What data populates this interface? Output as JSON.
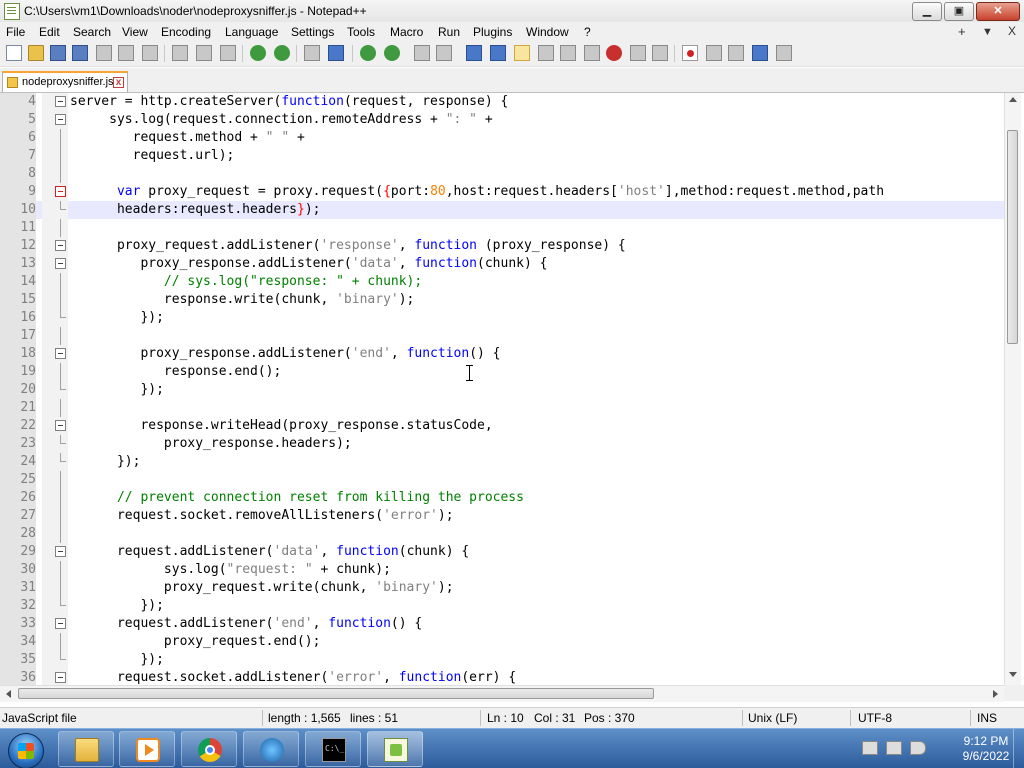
{
  "window": {
    "title": "C:\\Users\\vm1\\Downloads\\noder\\nodeproxysniffer.js - Notepad++",
    "minimize": "▁",
    "maximize": "▣",
    "close": "✕"
  },
  "menu": {
    "items": [
      "File",
      "Edit",
      "Search",
      "View",
      "Encoding",
      "Language",
      "Settings",
      "Tools",
      "Macro",
      "Run",
      "Plugins",
      "Window",
      "?"
    ],
    "right_plus": "+",
    "right_down": "▼",
    "right_close": "X"
  },
  "tab": {
    "label": "nodeproxysniffer.js",
    "close": "x"
  },
  "editor": {
    "lines": [
      {
        "n": "4",
        "html": "server = http.createServer(<span class='kw'>function</span>(request, response) {",
        "fold": "box",
        "current": false
      },
      {
        "n": "5",
        "html": "     sys.log(request.connection.remoteAddress + <span class='str'>\": \"</span> +",
        "fold": "box",
        "current": false
      },
      {
        "n": "6",
        "html": "        request.method + <span class='str'>\" \"</span> +",
        "fold": "line",
        "current": false
      },
      {
        "n": "7",
        "html": "        request.url);",
        "fold": "line",
        "current": false
      },
      {
        "n": "8",
        "html": "",
        "fold": "line",
        "current": false
      },
      {
        "n": "9",
        "html": "      <span class='kw'>var</span> proxy_request = proxy.request(<span class='brace-red'>{</span>port:<span class='num'>80</span>,host:request.headers[<span class='str'>'host'</span>],method:request.method,path",
        "fold": "redbox",
        "current": false
      },
      {
        "n": "10",
        "html": "      headers:request.headers<span class='brace-red'>}</span>);",
        "fold": "end",
        "current": true
      },
      {
        "n": "11",
        "html": "",
        "fold": "line",
        "current": false
      },
      {
        "n": "12",
        "html": "      proxy_request.addListener(<span class='str'>'response'</span>, <span class='kw'>function</span> (proxy_response) {",
        "fold": "box",
        "current": false
      },
      {
        "n": "13",
        "html": "         proxy_response.addListener(<span class='str'>'data'</span>, <span class='kw'>function</span>(chunk) {",
        "fold": "box",
        "current": false
      },
      {
        "n": "14",
        "html": "            <span class='com'>// sys.log(\"response: \" + chunk);</span>",
        "fold": "line",
        "current": false
      },
      {
        "n": "15",
        "html": "            response.write(chunk, <span class='str'>'binary'</span>);",
        "fold": "line",
        "current": false
      },
      {
        "n": "16",
        "html": "         });",
        "fold": "end",
        "current": false
      },
      {
        "n": "17",
        "html": "",
        "fold": "line",
        "current": false
      },
      {
        "n": "18",
        "html": "         proxy_response.addListener(<span class='str'>'end'</span>, <span class='kw'>function</span>() {",
        "fold": "box",
        "current": false
      },
      {
        "n": "19",
        "html": "            response.end();",
        "fold": "line",
        "current": false
      },
      {
        "n": "20",
        "html": "         });",
        "fold": "end",
        "current": false
      },
      {
        "n": "21",
        "html": "",
        "fold": "line",
        "current": false
      },
      {
        "n": "22",
        "html": "         response.writeHead(proxy_response.statusCode,",
        "fold": "box",
        "current": false
      },
      {
        "n": "23",
        "html": "            proxy_response.headers);",
        "fold": "end",
        "current": false
      },
      {
        "n": "24",
        "html": "      });",
        "fold": "end",
        "current": false
      },
      {
        "n": "25",
        "html": "",
        "fold": "line",
        "current": false
      },
      {
        "n": "26",
        "html": "      <span class='com'>// prevent connection reset from killing the process</span>",
        "fold": "line",
        "current": false
      },
      {
        "n": "27",
        "html": "      request.socket.removeAllListeners(<span class='str'>'error'</span>);",
        "fold": "line",
        "current": false
      },
      {
        "n": "28",
        "html": "",
        "fold": "line",
        "current": false
      },
      {
        "n": "29",
        "html": "      request.addListener(<span class='str'>'data'</span>, <span class='kw'>function</span>(chunk) {",
        "fold": "box",
        "current": false
      },
      {
        "n": "30",
        "html": "            sys.log(<span class='str'>\"request: \"</span> + chunk);",
        "fold": "line",
        "current": false
      },
      {
        "n": "31",
        "html": "            proxy_request.write(chunk, <span class='str'>'binary'</span>);",
        "fold": "line",
        "current": false
      },
      {
        "n": "32",
        "html": "         });",
        "fold": "end",
        "current": false
      },
      {
        "n": "33",
        "html": "      request.addListener(<span class='str'>'end'</span>, <span class='kw'>function</span>() {",
        "fold": "box",
        "current": false
      },
      {
        "n": "34",
        "html": "            proxy_request.end();",
        "fold": "line",
        "current": false
      },
      {
        "n": "35",
        "html": "         });",
        "fold": "end",
        "current": false
      },
      {
        "n": "36",
        "html": "      request.socket.addListener(<span class='str'>'error'</span>, <span class='kw'>function</span>(err) {",
        "fold": "box",
        "current": false
      }
    ]
  },
  "status": {
    "language": "JavaScript file",
    "length": "length : 1,565",
    "lines": "lines : 51",
    "ln": "Ln : 10",
    "col": "Col : 31",
    "pos": "Pos : 370",
    "eol": "Unix (LF)",
    "encoding": "UTF-8",
    "mode": "INS"
  },
  "taskbar": {
    "time": "9:12 PM",
    "date": "9/6/2022"
  },
  "colors": {
    "keyword": "#0000ff",
    "string": "#808080",
    "comment": "#008000",
    "number": "#ff8000",
    "current_line": "#e8e8ff"
  }
}
